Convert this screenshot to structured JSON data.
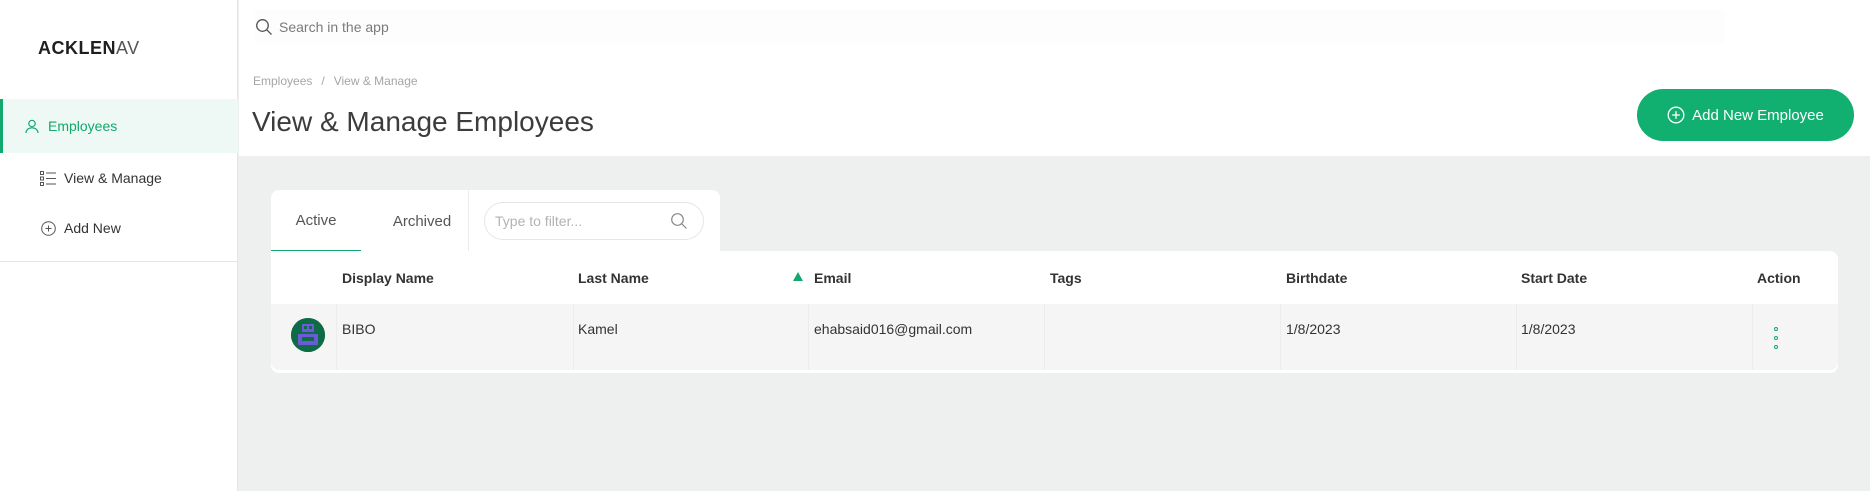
{
  "app": {
    "logo_text": "ACKLEN",
    "logo_tail": "AV"
  },
  "sidebar": {
    "items": [
      {
        "label": "Employees",
        "icon": "user-icon",
        "active": true
      },
      {
        "label": "View & Manage",
        "icon": "list-icon"
      },
      {
        "label": "Add New",
        "icon": "plus-circle-icon"
      }
    ]
  },
  "search": {
    "placeholder": "Search in the app"
  },
  "breadcrumb": {
    "items": [
      "Employees",
      "View & Manage"
    ],
    "separator": "/"
  },
  "page": {
    "title": "View & Manage Employees"
  },
  "actions": {
    "add_label": "Add New Employee"
  },
  "tabs": {
    "items": [
      {
        "label": "Active",
        "active": true
      },
      {
        "label": "Archived"
      }
    ],
    "filter_placeholder": "Type to filter..."
  },
  "table": {
    "columns": [
      "Display Name",
      "Last Name",
      "Email",
      "Tags",
      "Birthdate",
      "Start Date",
      "Action"
    ],
    "sorted_column": "Email",
    "rows": [
      {
        "display_name": "BIBO",
        "last_name": "Kamel",
        "email": "ehabsaid016@gmail.com",
        "tags": "",
        "birthdate": "1/8/2023",
        "start_date": "1/8/2023"
      }
    ]
  },
  "colors": {
    "accent": "#12a86e",
    "button": "#11b070",
    "background": "#eef0f0"
  }
}
